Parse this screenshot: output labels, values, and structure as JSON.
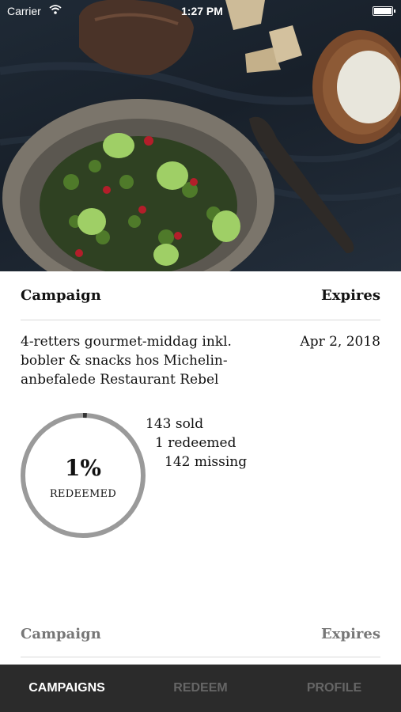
{
  "status_bar": {
    "carrier": "Carrier",
    "time": "1:27 PM"
  },
  "campaigns_list": {
    "header": {
      "campaign_label": "Campaign",
      "expires_label": "Expires"
    },
    "items": [
      {
        "title": "4-retters gourmet-middag inkl. bobler & snacks hos Michelin-anbefalede Restaurant Rebel",
        "expires": "Apr 2, 2018",
        "redeemed_percent": 1,
        "redeemed_percent_text": "1%",
        "redeemed_label": "REDEEMED",
        "stats": {
          "sold": "143 sold",
          "redeemed": "1 redeemed",
          "missing": "142 missing"
        }
      }
    ],
    "next_header": {
      "campaign_label": "Campaign",
      "expires_label": "Expires"
    }
  },
  "tab_bar": {
    "active": "campaigns",
    "tabs": [
      {
        "id": "campaigns",
        "label": "CAMPAIGNS"
      },
      {
        "id": "redeem",
        "label": "REDEEM"
      },
      {
        "id": "profile",
        "label": "PROFILE"
      }
    ]
  },
  "colors": {
    "ring_track": "#9a9a9a",
    "ring_progress": "#333333",
    "tabbar_bg": "#2b2b2b",
    "tab_active": "#ffffff",
    "tab_inactive": "#666666"
  }
}
